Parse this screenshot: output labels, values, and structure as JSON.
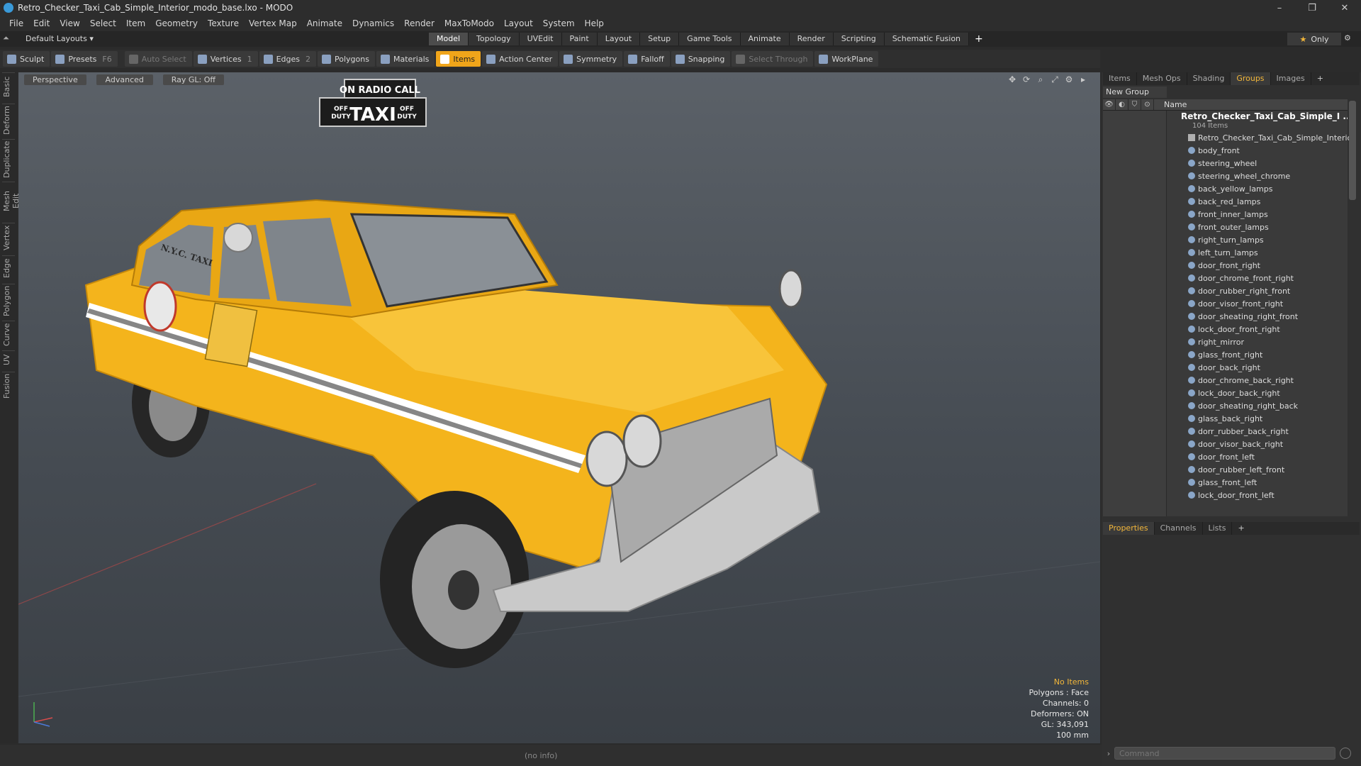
{
  "window": {
    "title": "Retro_Checker_Taxi_Cab_Simple_Interior_modo_base.lxo - MODO"
  },
  "menu": [
    "File",
    "Edit",
    "View",
    "Select",
    "Item",
    "Geometry",
    "Texture",
    "Vertex Map",
    "Animate",
    "Dynamics",
    "Render",
    "MaxToModo",
    "Layout",
    "System",
    "Help"
  ],
  "layouts": {
    "label": "Default Layouts",
    "only_label": "Only"
  },
  "layout_tabs": [
    {
      "label": "Model",
      "active": true
    },
    {
      "label": "Topology"
    },
    {
      "label": "UVEdit"
    },
    {
      "label": "Paint"
    },
    {
      "label": "Layout"
    },
    {
      "label": "Setup"
    },
    {
      "label": "Game Tools"
    },
    {
      "label": "Animate"
    },
    {
      "label": "Render"
    },
    {
      "label": "Scripting"
    },
    {
      "label": "Schematic Fusion"
    }
  ],
  "toolbar": {
    "sculpt": "Sculpt",
    "presets": "Presets",
    "presets_key": "F6",
    "auto_select": "Auto Select",
    "vertices": "Vertices",
    "vertices_key": "1",
    "edges": "Edges",
    "edges_key": "2",
    "polygons": "Polygons",
    "materials": "Materials",
    "items": "Items",
    "action_center": "Action Center",
    "symmetry": "Symmetry",
    "falloff": "Falloff",
    "snapping": "Snapping",
    "select_through": "Select Through",
    "workplane": "WorkPlane"
  },
  "left_tabs": [
    "Basic",
    "Deform",
    "Duplicate",
    "Mesh Edit",
    "Vertex",
    "Edge",
    "Polygon",
    "Curve",
    "UV",
    "Fusion"
  ],
  "viewport": {
    "view": "Perspective",
    "shading": "Advanced",
    "raygl": "Ray GL: Off",
    "taxi_sign_top": "ON RADIO CALL",
    "taxi_sign_main": "TAXI",
    "off_duty_line1": "OFF",
    "off_duty_line2": "DUTY",
    "door_lettering": "N.Y.C. TAXI",
    "hud": {
      "items": "No Items",
      "polygons": "Polygons : Face",
      "channels": "Channels: 0",
      "deformers": "Deformers: ON",
      "gl": "GL: 343,091",
      "scale": "100 mm"
    }
  },
  "status": {
    "info": "(no info)"
  },
  "right_tabs": [
    "Items",
    "Mesh Ops",
    "Shading",
    "Groups",
    "Images"
  ],
  "groups": {
    "new_group": "New Group",
    "name_header": "Name",
    "root_name": "Retro_Checker_Taxi_Cab_Simple_I ...",
    "root_count": "104 Items",
    "items": [
      "Retro_Checker_Taxi_Cab_Simple_Interior",
      "body_front",
      "steering_wheel",
      "steering_wheel_chrome",
      "back_yellow_lamps",
      "back_red_lamps",
      "front_inner_lamps",
      "front_outer_lamps",
      "right_turn_lamps",
      "left_turn_lamps",
      "door_front_right",
      "door_chrome_front_right",
      "door_rubber_right_front",
      "door_visor_front_right",
      "door_sheating_right_front",
      "lock_door_front_right",
      "right_mirror",
      "glass_front_right",
      "door_back_right",
      "door_chrome_back_right",
      "lock_door_back_right",
      "door_sheating_right_back",
      "glass_back_right",
      "dorr_rubber_back_right",
      "door_visor_back_right",
      "door_front_left",
      "door_rubber_left_front",
      "glass_front_left",
      "lock_door_front_left"
    ]
  },
  "props_tabs": [
    "Properties",
    "Channels",
    "Lists"
  ],
  "command": {
    "placeholder": "Command"
  },
  "colors": {
    "accent": "#f0a51a",
    "taxi_yellow": "#f4b41c"
  }
}
